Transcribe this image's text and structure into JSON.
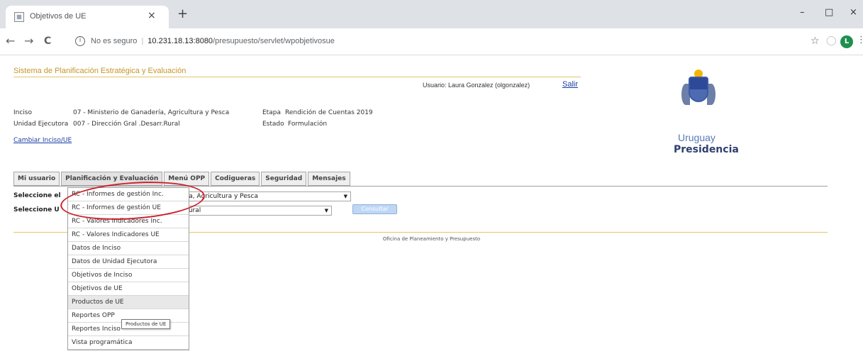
{
  "browser": {
    "tab_title": "Objetivos de UE",
    "tab_close": "×",
    "new_tab": "+",
    "win_min": "–",
    "win_max": "□",
    "win_close": "×",
    "back": "←",
    "forward": "→",
    "reload": "C",
    "address_security": "No es seguro",
    "address_host": "10.231.18.13:8080",
    "address_path": "/presupuesto/servlet/wpobjetivosue",
    "profile_initial": "L",
    "kebab": "⋮",
    "star": "☆",
    "ext": "◯"
  },
  "header": {
    "app_title": "Sistema de Planificación Estratégica y Evaluación",
    "user_label": "Usuario: Laura Gonzalez (olgonzalez)",
    "logout": "Salir",
    "inciso_label": "Inciso",
    "inciso_value": "07 - Ministerio de Ganadería, Agricultura y Pesca",
    "etapa_label": "Etapa",
    "etapa_value": "Rendición de Cuentas 2019",
    "ue_label": "Unidad Ejecutora",
    "ue_value": "007 - Dirección Gral .Desarr.Rural",
    "estado_label": "Estado",
    "estado_value": "Formulación",
    "change_link": "Cambiar Inciso/UE"
  },
  "logo": {
    "country": "Uruguay",
    "presidency": "Presidencia"
  },
  "menu": {
    "tabs": [
      "Mi usuario",
      "Planificación y Evaluación",
      "Menú OPP",
      "Codigueras",
      "Seguridad",
      "Mensajes"
    ]
  },
  "form": {
    "row1_label": "Seleccione el",
    "row1_select_value": "ría, Agricultura y Pesca",
    "row2_label": "Seleccione U",
    "row2_select_value": "Rural",
    "consult_button": "Consultar"
  },
  "footer": {
    "text": "Oficina de Planeamiento y Presupuesto"
  },
  "dropdown": {
    "items": [
      "RC - Informes de gestión Inc.",
      "RC - Informes de gestión UE",
      "RC - Valores Indicadores Inc.",
      "RC - Valores Indicadores UE",
      "Datos de Inciso",
      "Datos de Unidad Ejecutora",
      "Objetivos de Inciso",
      "Objetivos de UE",
      "Productos de UE",
      "Reportes OPP",
      "Reportes Inciso",
      "Vista programática"
    ],
    "hovered_index": 8,
    "tooltip": "Productos de UE"
  },
  "colors": {
    "title_gold": "#c6962a",
    "link_blue": "#1c3ea3",
    "annotation_red": "#cc1f2a"
  }
}
